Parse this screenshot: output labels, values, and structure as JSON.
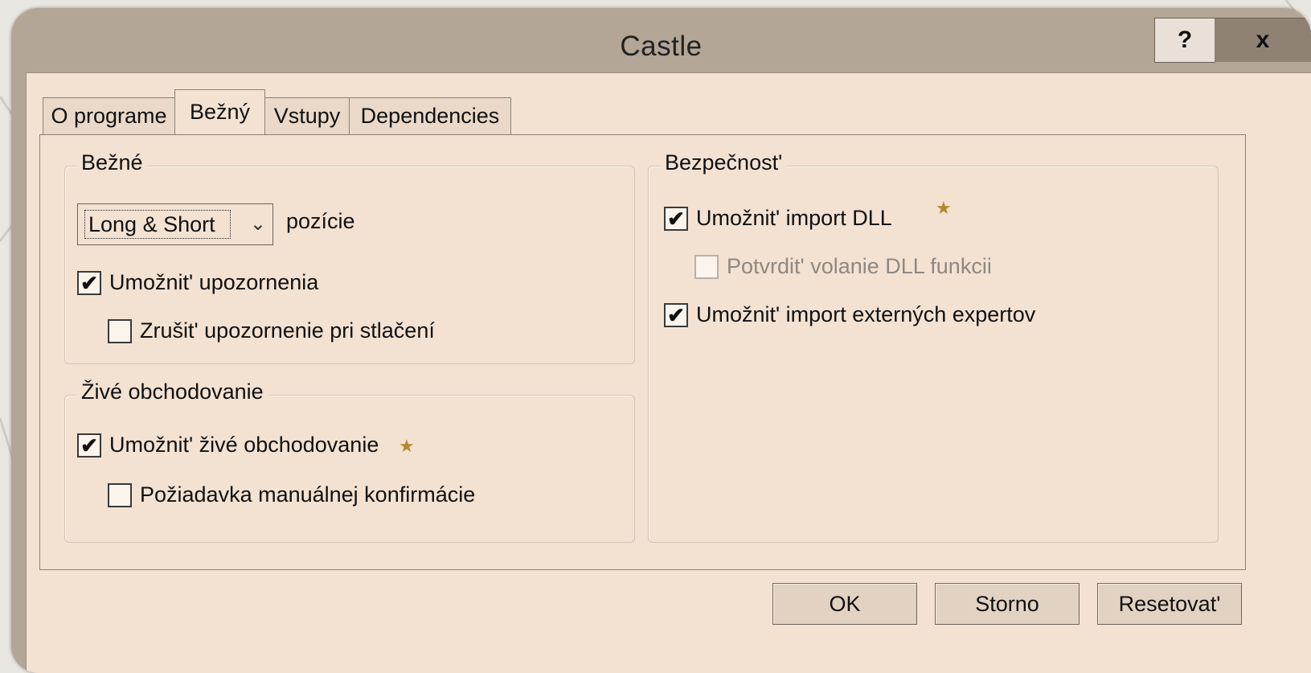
{
  "window": {
    "title": "Castle",
    "help_label": "?",
    "close_label": "x"
  },
  "tabs": [
    {
      "label": "O programe"
    },
    {
      "label": "Bežný"
    },
    {
      "label": "Vstupy"
    },
    {
      "label": "Dependencies"
    }
  ],
  "general": {
    "legend": "Bežné",
    "position_select": {
      "value": "Long & Short",
      "suffix": "pozície"
    },
    "allow_alerts": {
      "label": "Umožnit' upozornenia",
      "checked": true
    },
    "cancel_alert": {
      "label": "Zrušit' upozornenie pri stlačení",
      "checked": false
    }
  },
  "live": {
    "legend": "Živé obchodovanie",
    "allow_live": {
      "label": "Umožnit' živé obchodovanie",
      "checked": true
    },
    "manual_confirm": {
      "label": "Požiadavka manuálnej konfirmácie",
      "checked": false
    }
  },
  "security": {
    "legend": "Bezpečnost'",
    "allow_dll": {
      "label": "Umožnit' import DLL",
      "checked": true
    },
    "confirm_dll": {
      "label": "Potvrdit' volanie DLL funkcii",
      "checked": false,
      "disabled": true
    },
    "allow_experts": {
      "label": "Umožnit' import externých expertov",
      "checked": true
    }
  },
  "buttons": {
    "ok": "OK",
    "cancel": "Storno",
    "reset": "Resetovat'"
  },
  "icons": {
    "check": "✔",
    "star": "★",
    "chevron": "⌄"
  },
  "colors": {
    "window": "#b3a696",
    "client": "#f3e2d2",
    "star": "#b8862e"
  }
}
